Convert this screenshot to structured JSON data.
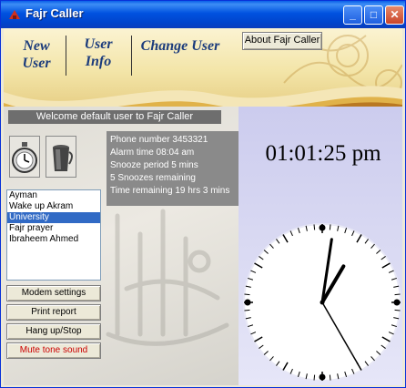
{
  "window": {
    "title": "Fajr Caller",
    "buttons": {
      "minimize": "_",
      "maximize": "□",
      "close": "✕"
    }
  },
  "nav": {
    "new_user": [
      "New",
      "User"
    ],
    "user_info": [
      "User",
      "Info"
    ],
    "change_user": "Change User",
    "about_button": "About Fajr Caller"
  },
  "welcome": "Welcome default user to Fajr Caller",
  "icons": {
    "alarm": "stopwatch-icon",
    "mug": "coffee-mug-icon"
  },
  "info": {
    "phone": "Phone number 3453321",
    "alarm_time": "Alarm time   08:04 am",
    "snooze_period": "Snooze period  5 mins",
    "snoozes": "5 Snoozes remaining",
    "time_remaining": "Time remaining 19 hrs 3 mins"
  },
  "alarms": [
    {
      "label": "Ayman",
      "selected": false
    },
    {
      "label": "Wake up Akram",
      "selected": false
    },
    {
      "label": "University",
      "selected": true
    },
    {
      "label": "Fajr prayer",
      "selected": false
    },
    {
      "label": "Ibraheem Ahmed",
      "selected": false
    }
  ],
  "buttons": {
    "modem": "Modem settings",
    "print": "Print report",
    "hangup": "Hang up/Stop",
    "mute": "Mute tone sound"
  },
  "clock": {
    "digital": "01:01:25 pm",
    "hour": 1,
    "minute": 1,
    "second": 25
  },
  "colors": {
    "title_bar": "#0052e0",
    "selection": "#316ac5",
    "mute_text": "#cc0000",
    "nav_text": "#1c3c7c"
  }
}
